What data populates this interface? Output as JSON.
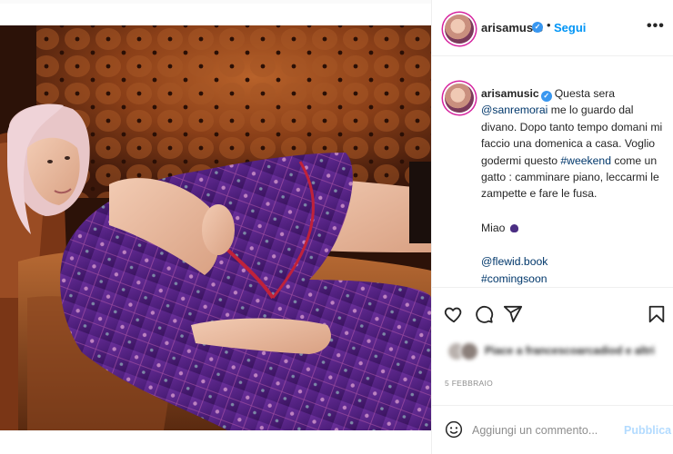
{
  "post": {
    "username": "arisamusic",
    "follow_label": "Segui",
    "more_label": "•••",
    "dot": "•",
    "verified_mark": "✓",
    "caption": {
      "username": "arisamusic",
      "line1_before": "Questa sera ",
      "mention1": "@sanremorai",
      "line1_after": " me lo guardo dal divano. Dopo tanto tempo domani mi faccio una domenica a casa. Voglio godermi questo ",
      "hashtag1": "#weekend",
      "line1_end": " come un gatto : camminare piano, leccarmi le zampette e fare le fusa.",
      "meow": "Miao",
      "mention2": "@flewid.book",
      "hashtag2": "#comingsoon"
    },
    "likes_text": "Piace a francescoarcadiod e altri",
    "date": "5 FEBBRAIO",
    "comment_placeholder": "Aggiungi un commento...",
    "publish_label": "Pubblica"
  },
  "colors": {
    "accent_blue": "#0095f6",
    "link_dark_blue": "#00376b",
    "publish_disabled": "#b3dbff",
    "verified_badge": "#3897f0",
    "robe_purple": "#5a2a86"
  },
  "icons": {
    "like": "heart-icon",
    "comment": "comment-icon",
    "share": "share-icon",
    "save": "bookmark-icon",
    "emoji": "emoji-icon",
    "more": "more-options-icon",
    "verified": "verified-badge-icon"
  }
}
